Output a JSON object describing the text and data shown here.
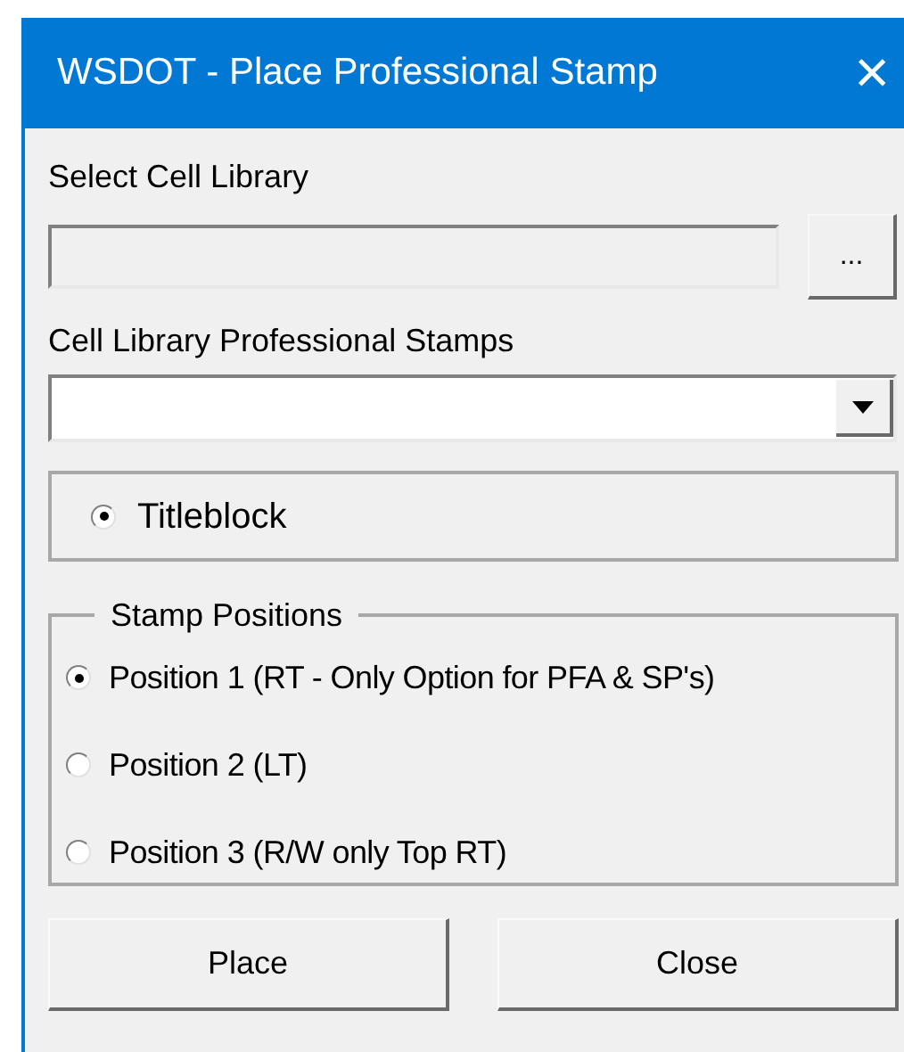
{
  "window": {
    "title": "WSDOT - Place Professional Stamp",
    "close": "×"
  },
  "cell_library": {
    "label": "Select Cell Library",
    "disabled": true,
    "browse": "..."
  },
  "stamps": {
    "label": "Cell Library Professional Stamps"
  },
  "titleblock": {
    "label": "Titleblock",
    "selected": true
  },
  "stamp_positions": {
    "title": "Stamp Positions",
    "options": [
      {
        "label": "Position 1 (RT - Only Option for PFA & SP's)",
        "selected": true
      },
      {
        "label": "Position 2 (LT)",
        "selected": false
      },
      {
        "label": "Position 3 (R/W only Top RT)",
        "selected": false
      }
    ]
  },
  "buttons": [
    "Place",
    "Close"
  ]
}
